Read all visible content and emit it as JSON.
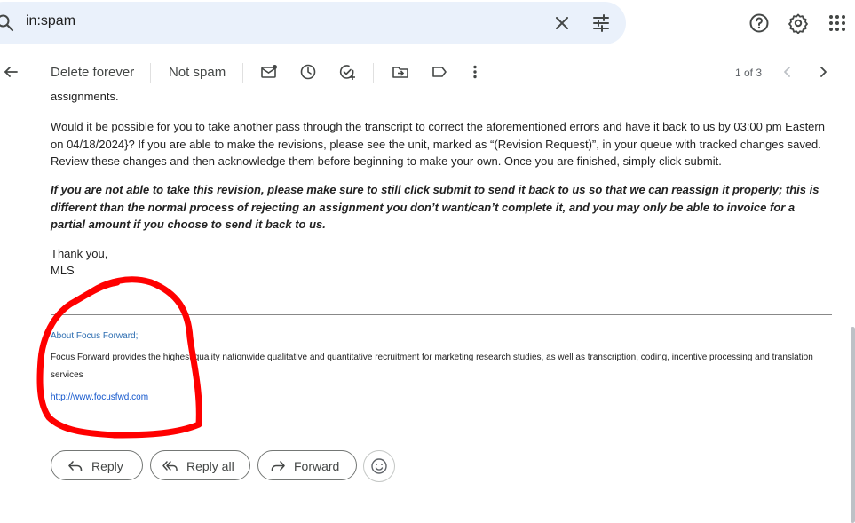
{
  "search": {
    "query": "in:spam"
  },
  "toolbar": {
    "delete_forever": "Delete forever",
    "not_spam": "Not spam",
    "pager": "1 of 3"
  },
  "email": {
    "cut_line": "assignments.",
    "paragraph1": "Would it be possible for you to take another pass through the transcript to correct the aforementioned errors and have it back to us by 03:00 pm Eastern on 04/18/2024}? If you are able to make the revisions, please see the unit, marked as “(Revision Request)”, in your queue with tracked changes saved. Review these changes and then acknowledge them before beginning to make your own. Once you are finished, simply click submit.",
    "paragraph2": "If you are not able to take this revision, please make sure to still click submit to send it back to us so that we can reassign it properly; this is different than the normal process of rejecting an assignment you don’t want/can’t complete it, and you may only be able to invoice for a partial amount if you choose to send it back to us.",
    "thanks": "Thank you,",
    "signature": "MLS",
    "footer_heading": "About Focus Forward;",
    "footer_text": "Focus Forward provides the highest quality nationwide qualitative and quantitative recruitment for marketing research studies, as well as transcription, coding, incentive processing and translation services",
    "footer_link": "http://www.focusfwd.com"
  },
  "actions": {
    "reply": "Reply",
    "reply_all": "Reply all",
    "forward": "Forward"
  },
  "colors": {
    "search_bg": "#eaf1fb",
    "annotation_red": "#ff0000",
    "link_blue": "#1155cc"
  }
}
